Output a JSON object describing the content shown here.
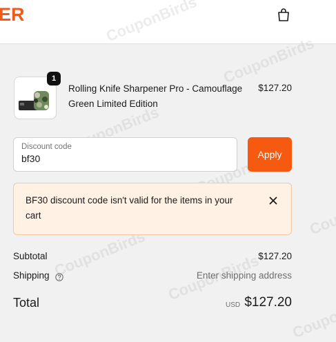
{
  "header": {
    "logo_text": "ER",
    "cart_icon": "shopping-bag-icon"
  },
  "product": {
    "quantity": "1",
    "name": "Rolling Knife Sharpener Pro - Camouflage Green Limited Edition",
    "price": "$127.20"
  },
  "discount": {
    "label": "Discount code",
    "value": "bf30",
    "apply_label": "Apply"
  },
  "alert": {
    "message": "BF30 discount code isn't valid for the items in your cart",
    "close_icon": "close-icon"
  },
  "summary": {
    "subtotal_label": "Subtotal",
    "subtotal_value": "$127.20",
    "shipping_label": "Shipping",
    "shipping_value": "Enter shipping address",
    "total_label": "Total",
    "currency": "USD",
    "total_value": "$127.20"
  },
  "watermark": {
    "text": "CouponBirds"
  },
  "colors": {
    "accent": "#f55a10",
    "alert_bg": "#fff2e5",
    "background": "#f1f1f1"
  }
}
